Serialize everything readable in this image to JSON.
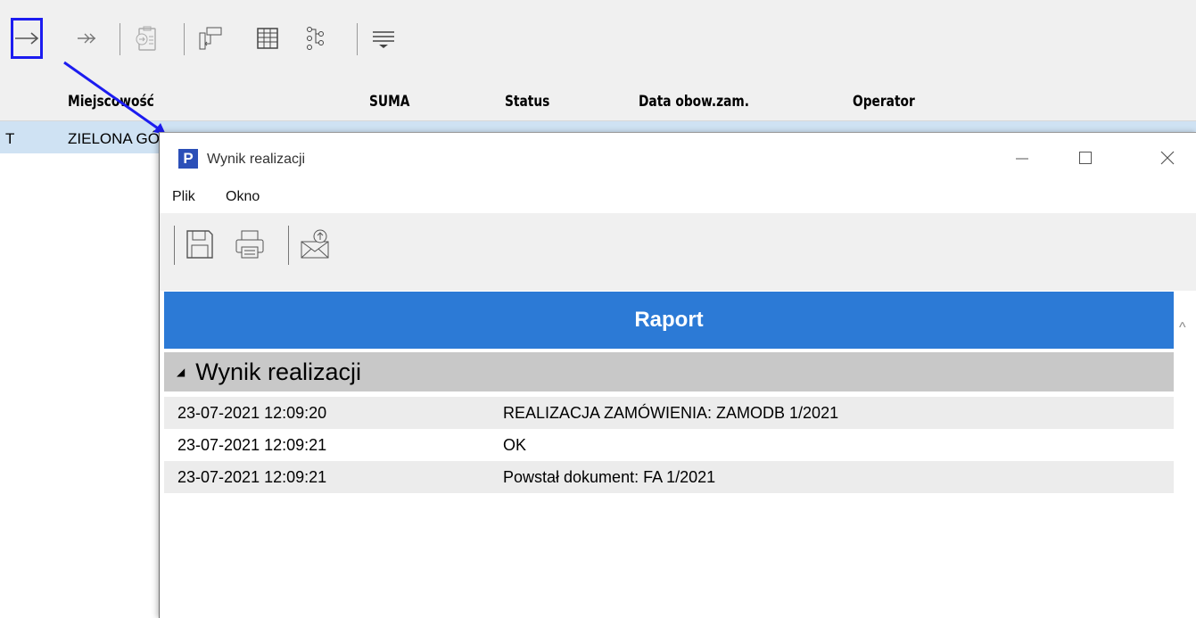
{
  "toolbar": {
    "buttons": [
      "arrow-right",
      "double-arrow-right",
      "clipboard-arrow",
      "column-move",
      "grid-table",
      "tree-nodes",
      "filter-lines"
    ],
    "active_button": "arrow-right"
  },
  "grid": {
    "columns": [
      "Miejscowość",
      "SUMA",
      "Status",
      "Data obow.zam.",
      "Operator"
    ],
    "row": {
      "left_fragment": "T",
      "miejscowosc": "ZIELONA GÓRA"
    }
  },
  "dialog": {
    "title": "Wynik realizacji",
    "logo_letter": "P",
    "menu": [
      "Plik",
      "Okno"
    ],
    "toolbar_icons": [
      "save-icon",
      "print-icon",
      "email-icon"
    ],
    "report_title": "Raport",
    "group_title": "Wynik realizacji",
    "rows": [
      {
        "date": "23-07-2021 12:09:20",
        "message": "REALIZACJA ZAMÓWIENIA: ZAMODB 1/2021"
      },
      {
        "date": "23-07-2021 12:09:21",
        "message": "OK"
      },
      {
        "date": "23-07-2021 12:09:21",
        "message": "Powstał dokument: FA 1/2021"
      }
    ]
  },
  "colors": {
    "report_header": "#2c7ad6",
    "selected_row": "#cfe2f3",
    "highlight": "#1c1cf0"
  }
}
